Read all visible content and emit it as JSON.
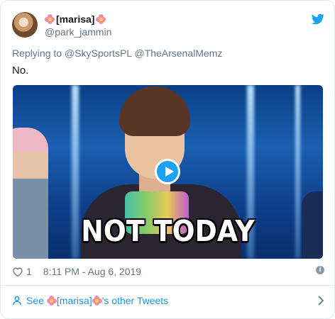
{
  "tweet": {
    "display_name": "[marisa]",
    "handle": "@park_jammin",
    "reply_text": "Replying to @SkySportsPL @TheArsenalMemz",
    "text": "No.",
    "media": {
      "caption": "NOT TODAY",
      "play_icon": "play-icon"
    },
    "likes": "1",
    "timestamp": "8:11 PM - Aug 6, 2019"
  },
  "footer": {
    "see_label": "See",
    "name": "[marisa]",
    "suffix": "'s other Tweets"
  },
  "colors": {
    "accent": "#1da1f2",
    "link": "#1b95e0",
    "muted": "#657786"
  }
}
